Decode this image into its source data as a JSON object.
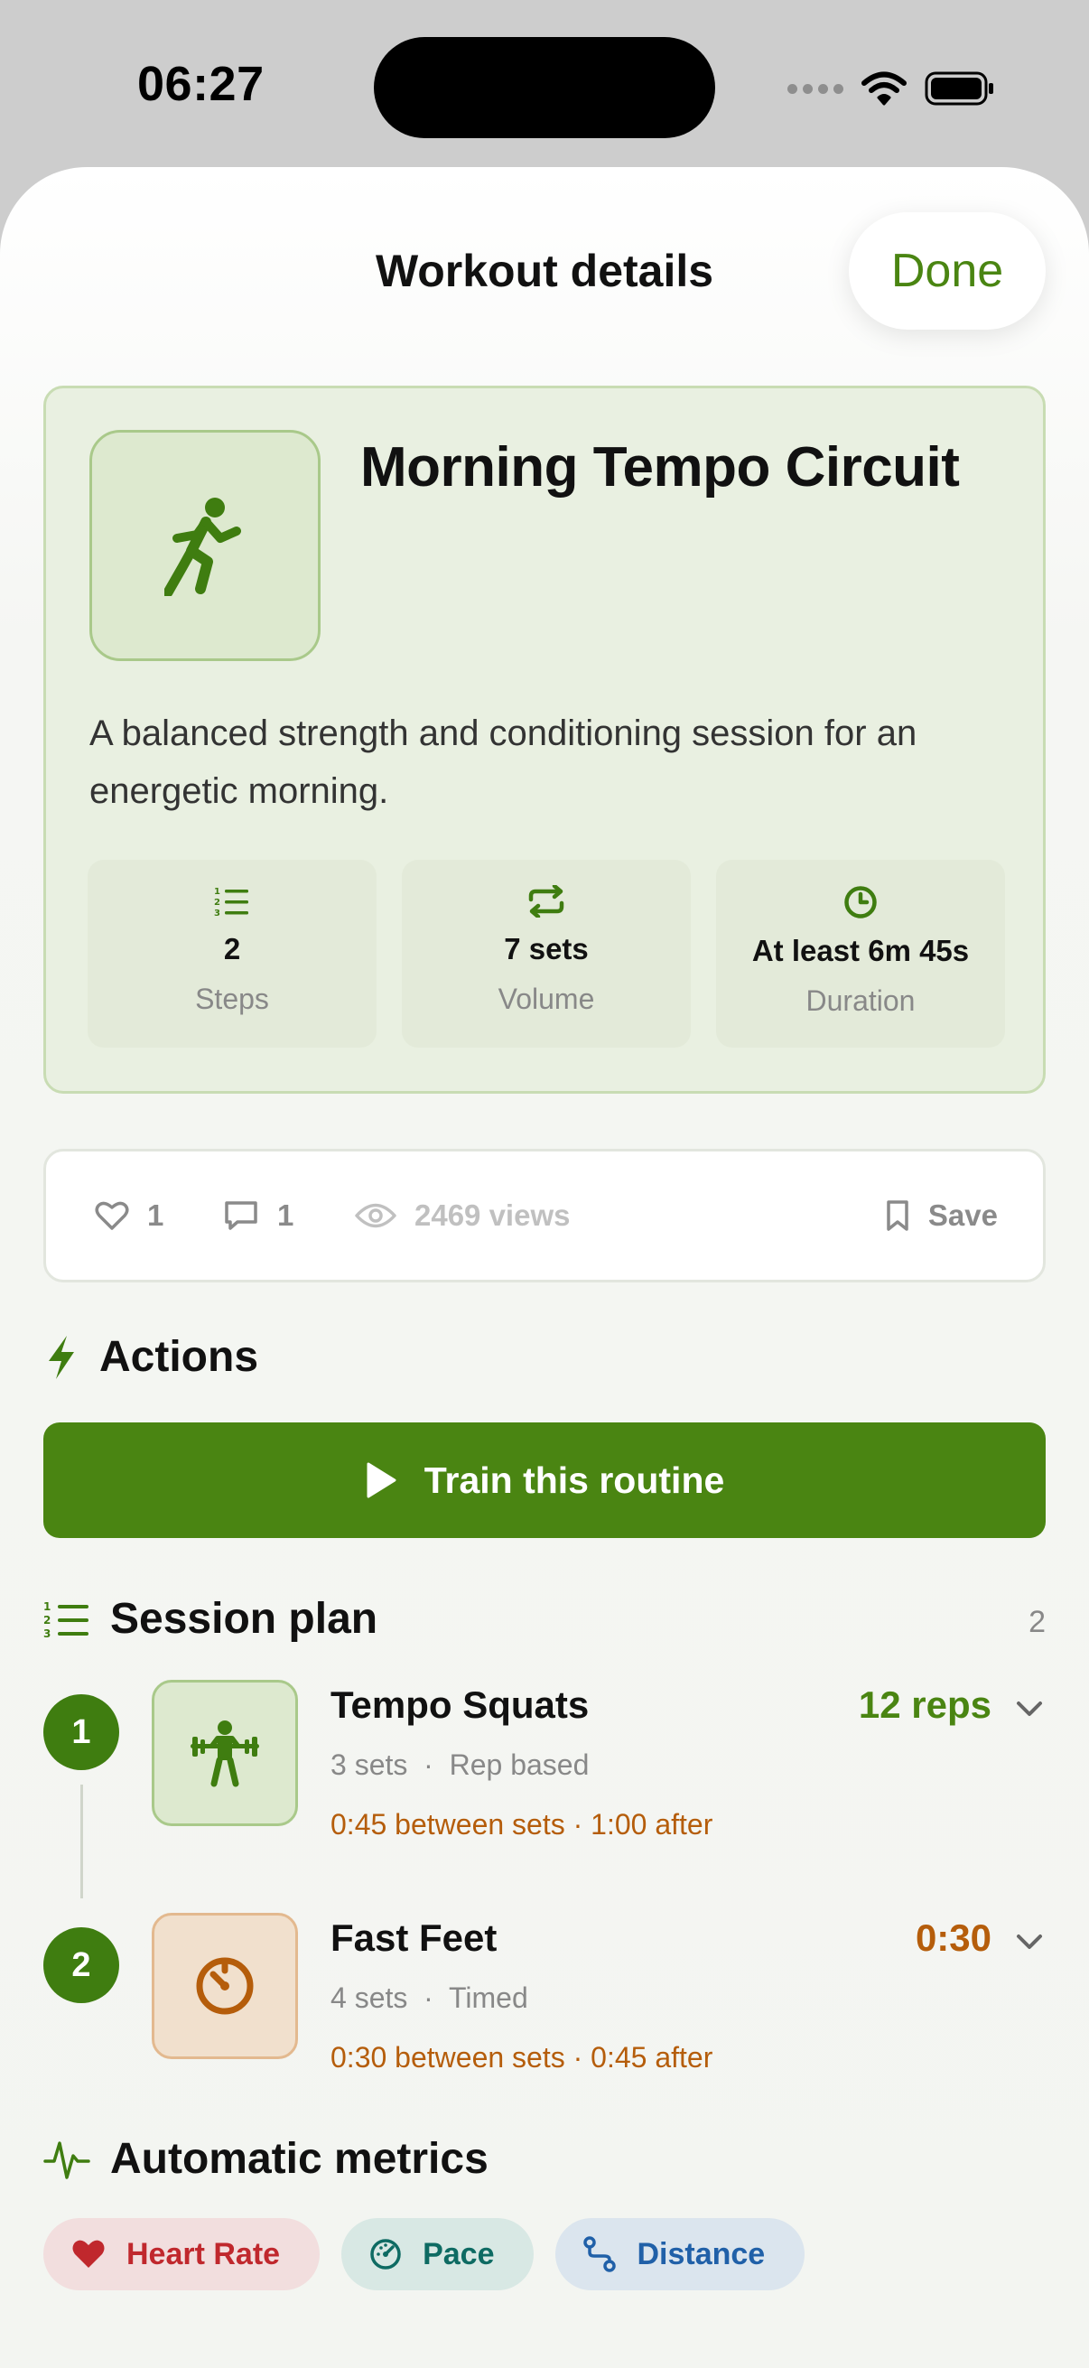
{
  "status_bar": {
    "time": "06:27"
  },
  "sheet": {
    "title": "Workout details",
    "done_label": "Done"
  },
  "workout": {
    "title": "Morning Tempo Circuit",
    "icon": "running-icon",
    "description": "A balanced strength and conditioning session for an energetic morning.",
    "stats": [
      {
        "icon": "numbered-list-icon",
        "value": "2",
        "label": "Steps"
      },
      {
        "icon": "repeat-icon",
        "value": "7 sets",
        "label": "Volume"
      },
      {
        "icon": "clock-icon",
        "value": "At least 6m 45s",
        "label": "Duration"
      }
    ]
  },
  "social": {
    "likes": "1",
    "comments": "1",
    "views": "2469 views",
    "save_label": "Save"
  },
  "actions": {
    "title": "Actions",
    "train_label": "Train this routine"
  },
  "session_plan": {
    "title": "Session plan",
    "count": "2",
    "steps": [
      {
        "number": "1",
        "name": "Tempo Squats",
        "sets": "3 sets",
        "mode": "Rep based",
        "target": "12 reps",
        "rest": "0:45 between sets · 1:00 after",
        "icon": "weightlifting-icon"
      },
      {
        "number": "2",
        "name": "Fast Feet",
        "sets": "4 sets",
        "mode": "Timed",
        "target": "0:30",
        "rest": "0:30 between sets · 0:45 after",
        "icon": "timer-icon"
      }
    ]
  },
  "metrics": {
    "title": "Automatic metrics",
    "chips": [
      {
        "label": "Heart Rate",
        "icon": "heart-icon"
      },
      {
        "label": "Pace",
        "icon": "speedometer-icon"
      },
      {
        "label": "Distance",
        "icon": "route-icon"
      }
    ]
  },
  "colors": {
    "accent": "#4a8512",
    "rest_orange": "#b55d0b",
    "heart_red": "#c0282d",
    "pace_teal": "#0e6b63",
    "distance_blue": "#2060a8"
  }
}
